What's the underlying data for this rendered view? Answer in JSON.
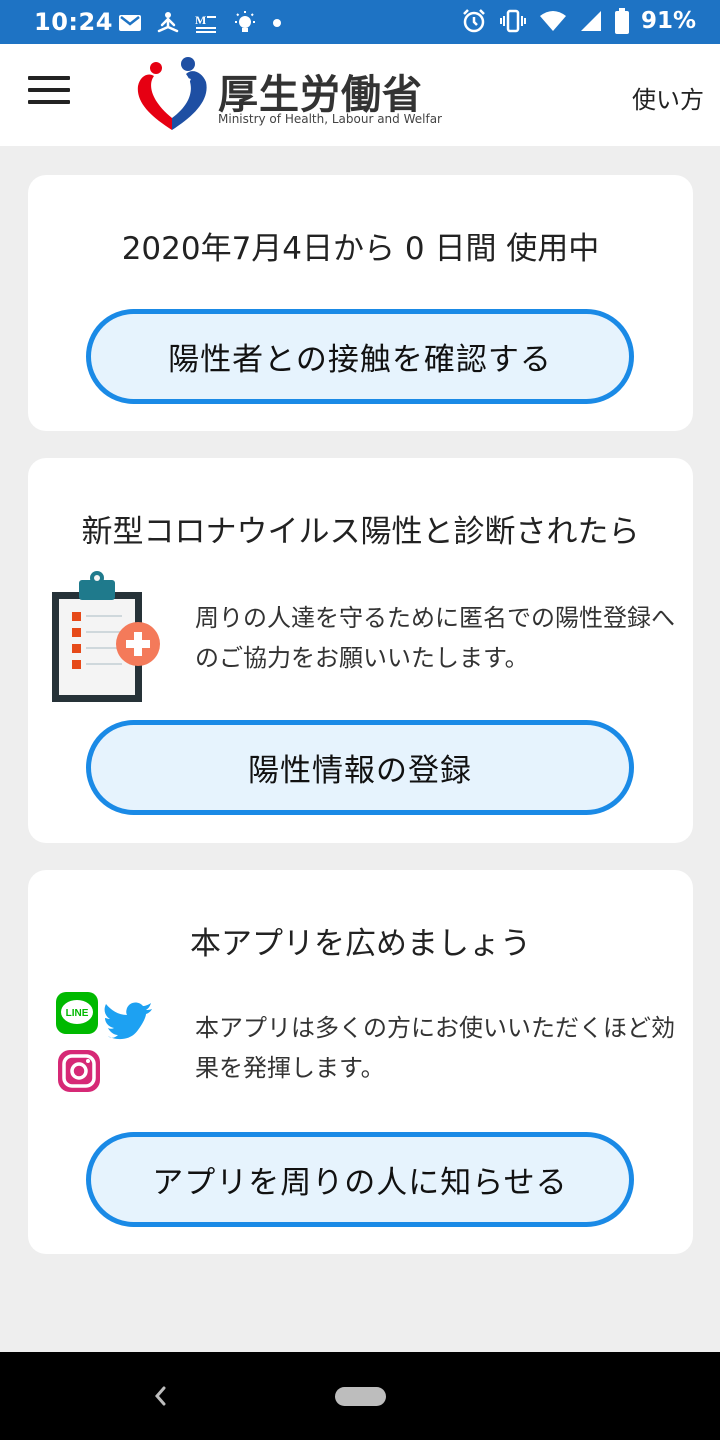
{
  "status_bar": {
    "time": "10:24",
    "battery": "91%",
    "icons_left": [
      "gmail-icon",
      "meditation-icon",
      "news-icon",
      "lightbulb-icon",
      "dot-icon"
    ],
    "icons_right": [
      "alarm-icon",
      "vibrate-icon",
      "wifi-icon",
      "signal-icon",
      "battery-icon"
    ]
  },
  "header": {
    "logo_text": "厚生労働省",
    "logo_subtext": "Ministry of Health, Labour and Welfar",
    "help_label": "使い方",
    "menu_icon": "hamburger-menu-icon",
    "brand_color": "#1e73c4"
  },
  "usage": {
    "text": "2020年7月4日から 0 日間 使用中",
    "button_label": "陽性者との接触を確認する"
  },
  "positive_section": {
    "title": "新型コロナウイルス陽性と診断されたら",
    "description": "周りの人達を守るために匿名での陽性登録へのご協力をお願いいたします。",
    "button_label": "陽性情報の登録",
    "icon": "clipboard-medical-icon"
  },
  "share_section": {
    "title": "本アプリを広めましょう",
    "description": "本アプリは多くの方にお使いいただくほど効果を発揮します。",
    "button_label": "アプリを周りの人に知らせる",
    "line_label": "LINE",
    "icons": [
      "line-icon",
      "twitter-icon",
      "instagram-icon"
    ]
  },
  "colors": {
    "button_border": "#1a8ae6",
    "button_fill": "#e6f3fd",
    "background": "#eeeeee"
  }
}
